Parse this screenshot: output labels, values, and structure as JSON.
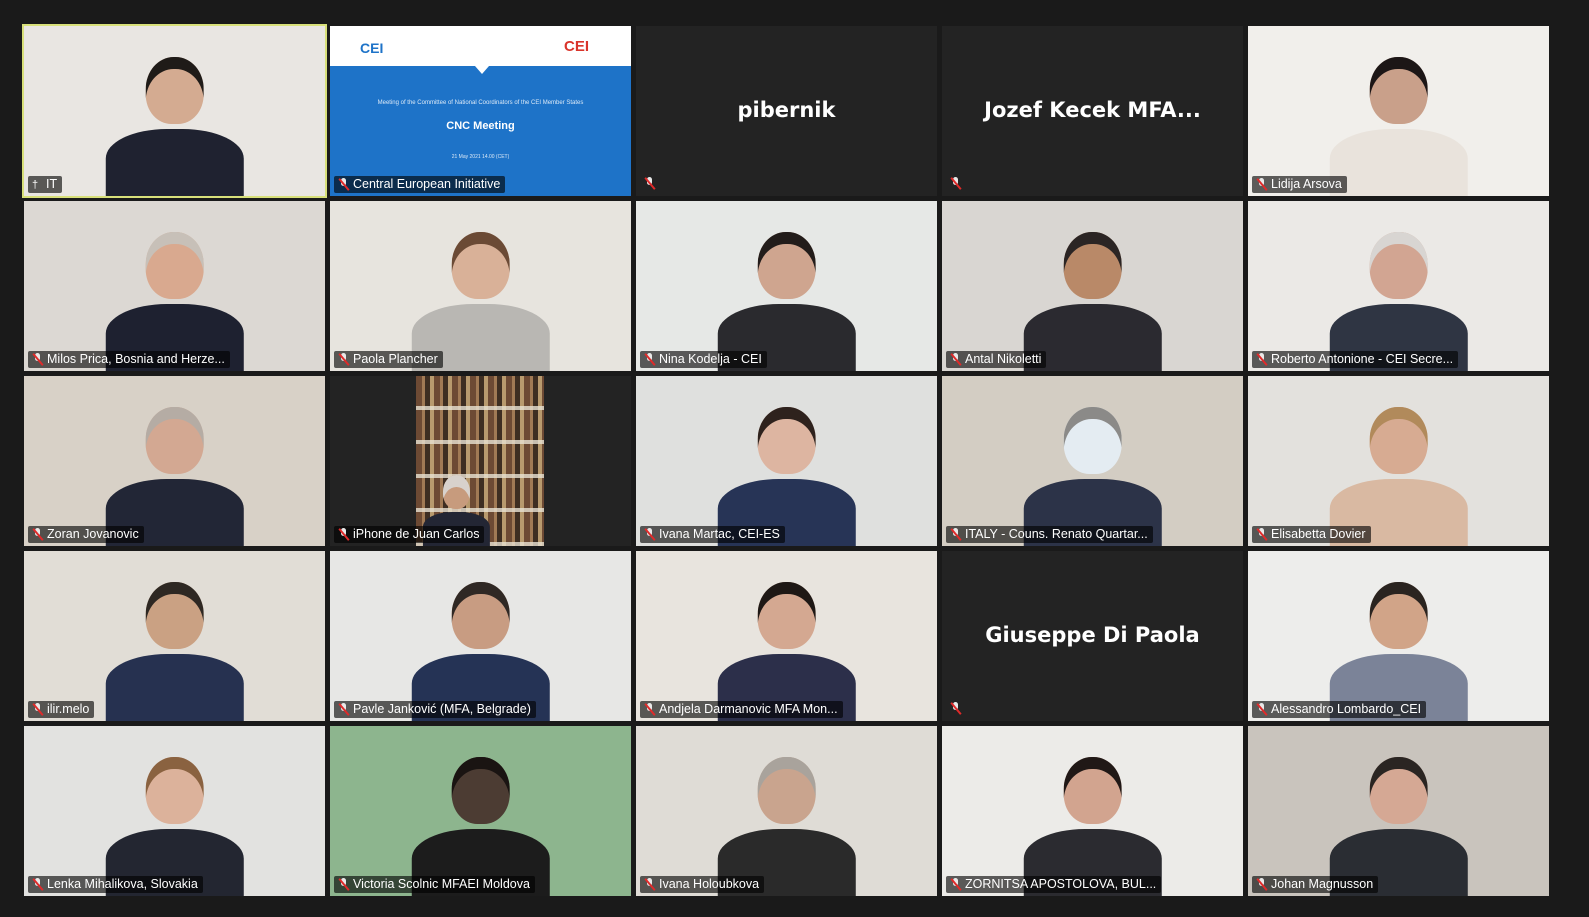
{
  "meeting": {
    "tiles": [
      {
        "name": "IT",
        "video": true,
        "active": true,
        "pinned": true,
        "bg": "#e9e6e2",
        "skin": "#d4ab91",
        "hair": "#1f1b18",
        "suit": "#1f2230"
      },
      {
        "name": "Central European Initiative",
        "video": true,
        "screen_share": true
      },
      {
        "name": "pibernik",
        "video": false
      },
      {
        "name": "Jozef Kecek MFA...",
        "video": false
      },
      {
        "name": "Lidija Arsova",
        "video": true,
        "bg": "#f1efeb",
        "skin": "#c9a08a",
        "hair": "#1c1616",
        "suit": "#e9e3dc"
      },
      {
        "name": "Milos Prica, Bosnia and Herze...",
        "video": true,
        "bg": "#dcd8d3",
        "skin": "#d9a98f",
        "hair": "#c7c0b8",
        "suit": "#1e2130"
      },
      {
        "name": "Paola Plancher",
        "video": true,
        "bg": "#e7e4de",
        "skin": "#d9b198",
        "hair": "#6b4a35",
        "suit": "#b9b7b3"
      },
      {
        "name": "Nina Kodelja - CEI",
        "video": true,
        "bg": "#e6e8e6",
        "skin": "#cfa58f",
        "hair": "#221c1a",
        "suit": "#2a2a2e"
      },
      {
        "name": "Antal Nikoletti",
        "video": true,
        "bg": "#d9d6d2",
        "skin": "#b98968",
        "hair": "#2b2524",
        "suit": "#2b2a30"
      },
      {
        "name": "Roberto Antonione - CEI Secre...",
        "video": true,
        "bg": "#ebe9e6",
        "skin": "#d2a592",
        "hair": "#d8d5d2",
        "suit": "#2f3543"
      },
      {
        "name": "Zoran Jovanovic",
        "video": true,
        "bg": "#d8d1c7",
        "skin": "#d3a892",
        "hair": "#b5aca4",
        "suit": "#222636"
      },
      {
        "name": "iPhone de Juan Carlos",
        "video": true,
        "books": true
      },
      {
        "name": "Ivana Martac, CEI-ES",
        "video": true,
        "bg": "#dfe0de",
        "skin": "#ddb5a1",
        "hair": "#2e221d",
        "suit": "#273456"
      },
      {
        "name": "ITALY - Couns. Renato Quartar...",
        "video": true,
        "bg": "#d3cdc3",
        "skin": "#e4ecf2",
        "hair": "#8b8a88",
        "suit": "#2c3348"
      },
      {
        "name": "Elisabetta Dovier",
        "video": true,
        "bg": "#e3e1dd",
        "skin": "#d7ab92",
        "hair": "#b18a5b",
        "suit": "#d9b9a2"
      },
      {
        "name": "ilir.melo",
        "video": true,
        "bg": "#e1ddd6",
        "skin": "#caa183",
        "hair": "#2e2823",
        "suit": "#263150"
      },
      {
        "name": "Pavle Janković (MFA, Belgrade)",
        "video": true,
        "bg": "#e7e7e5",
        "skin": "#c89c82",
        "hair": "#2f2824",
        "suit": "#253355"
      },
      {
        "name": "Andjela Darmanovic MFA Mon...",
        "video": true,
        "bg": "#e8e4de",
        "skin": "#d4a891",
        "hair": "#1e1815",
        "suit": "#2c2f4a"
      },
      {
        "name": "Giuseppe Di Paola",
        "video": false
      },
      {
        "name": "Alessandro Lombardo_CEI",
        "video": true,
        "bg": "#ededeb",
        "skin": "#d1a488",
        "hair": "#2a2420",
        "suit": "#7b8398"
      },
      {
        "name": "Lenka Mihalikova, Slovakia",
        "video": true,
        "bg": "#e2e2e0",
        "skin": "#dcb29b",
        "hair": "#8a6240",
        "suit": "#232631"
      },
      {
        "name": "Victoria Scolnic MFAEI Moldova",
        "video": true,
        "bg": "#8db58e",
        "skin": "#4c3c33",
        "hair": "#1a1412",
        "suit": "#1c1c1c"
      },
      {
        "name": "Ivana Holoubkova",
        "video": true,
        "bg": "#dfdcd6",
        "skin": "#c9a48e",
        "hair": "#a9a39c",
        "suit": "#2a2a2a"
      },
      {
        "name": "ZORNITSA APOSTOLOVA, BUL...",
        "video": true,
        "bg": "#ecebe8",
        "skin": "#d2a48f",
        "hair": "#201816",
        "suit": "#2b2b30"
      },
      {
        "name": "Johan Magnusson",
        "video": true,
        "bg": "#c9c4bd",
        "skin": "#d5a894",
        "hair": "#2a2522",
        "suit": "#2a2d33"
      }
    ],
    "slide": {
      "logo_left": "CEI",
      "logo_right": "CEI",
      "subtitle": "Meeting of the Committee of National Coordinators of the CEI Member States",
      "title": "CNC Meeting",
      "date": "21 May 2021 14.00 (CET)"
    }
  }
}
